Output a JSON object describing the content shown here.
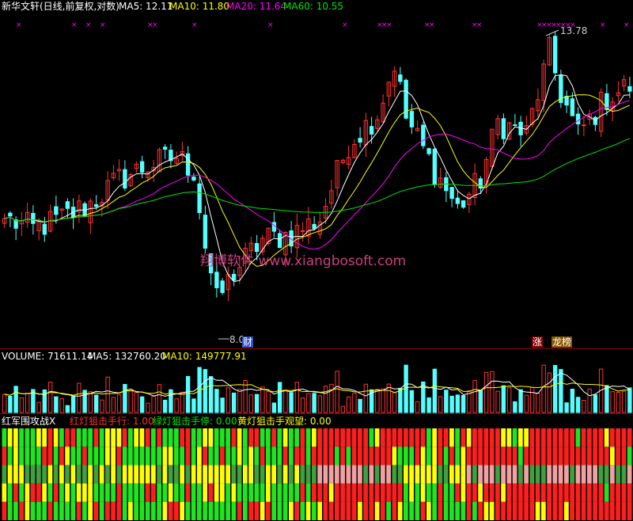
{
  "main_panel": {
    "title": "新华文轩(日线,前复权,对数)",
    "ma5": "MA5: 12.11",
    "ma10": "MA10: 11.80",
    "ma20": "MA20: 11.64",
    "ma60": "MA60: 10.55",
    "high_label": "13.78",
    "low_label": "8.0",
    "watermark": "翔博软件 www.xiangbosoft.com",
    "badge_cai": "财",
    "badge_zhang": "涨",
    "badge_long": "龙榜"
  },
  "volume_panel": {
    "label": "VOLUME: 71611.14",
    "ma5": "MA5: 132760.20",
    "ma10": "MA10: 149777.91"
  },
  "indicator_panel": {
    "name": "红军围攻战X",
    "red": "红灯狙击手行: 1.00",
    "green": "绿灯狙击手停: 0.00",
    "yellow": "黄灯狙击手观望: 0.00"
  },
  "colors": {
    "up": "#ff3232",
    "down": "#54ffff",
    "ma5": "#ffffff",
    "ma10": "#ffff00",
    "ma20": "#ff00ff",
    "ma60": "#00e600",
    "grid_red": "#8b0000"
  },
  "chart_data": {
    "type": "candlestick",
    "y_scale": "log",
    "ylim": [
      7.6,
      14.3
    ],
    "days": 110,
    "high": 13.78,
    "low": 8.0,
    "close_path": [
      [
        0,
        9.6
      ],
      [
        5,
        9.4
      ],
      [
        10,
        9.6
      ],
      [
        15,
        9.9
      ],
      [
        20,
        10.4
      ],
      [
        25,
        10.7
      ],
      [
        30,
        10.9
      ],
      [
        33,
        10.6
      ],
      [
        35,
        9.1
      ],
      [
        37,
        8.1
      ],
      [
        40,
        8.6
      ],
      [
        45,
        9.2
      ],
      [
        50,
        9.3
      ],
      [
        55,
        9.6
      ],
      [
        60,
        11.2
      ],
      [
        65,
        11.9
      ],
      [
        68,
        13.2
      ],
      [
        70,
        11.8
      ],
      [
        75,
        10.6
      ],
      [
        79,
        9.8
      ],
      [
        83,
        10.4
      ],
      [
        86,
        11.7
      ],
      [
        91,
        11.4
      ],
      [
        95,
        13.5
      ],
      [
        97,
        12.4
      ],
      [
        100,
        11.4
      ],
      [
        105,
        12.3
      ],
      [
        109,
        12.6
      ]
    ],
    "volume_ylim": [
      0,
      250000
    ],
    "indicator_rows": 5
  }
}
